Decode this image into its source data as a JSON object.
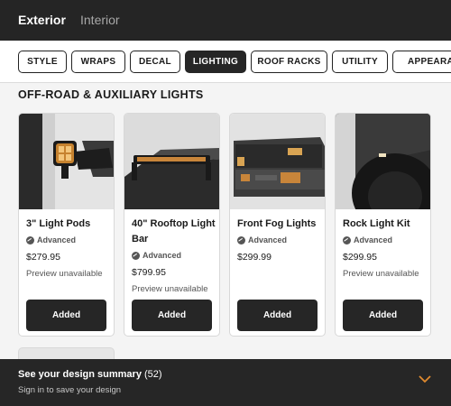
{
  "header": {
    "tabs": [
      {
        "label": "Exterior",
        "active": true
      },
      {
        "label": "Interior",
        "active": false
      }
    ]
  },
  "filters": [
    {
      "label": "STYLE",
      "active": false
    },
    {
      "label": "WRAPS",
      "active": false
    },
    {
      "label": "DECAL",
      "active": false
    },
    {
      "label": "LIGHTING",
      "active": true
    },
    {
      "label": "ROOF RACKS",
      "active": false
    },
    {
      "label": "UTILITY",
      "active": false
    },
    {
      "label": "APPEARAN",
      "active": false
    }
  ],
  "section": {
    "title": "OFF-ROAD & AUXILIARY LIGHTS"
  },
  "products": [
    {
      "name": "3\" Light Pods",
      "badge": "Advanced",
      "price": "$279.95",
      "note": "Preview unavailable",
      "button": "Added",
      "image_icon": "light-pod-image"
    },
    {
      "name": "40\" Rooftop Light Bar",
      "badge": "Advanced",
      "price": "$799.95",
      "note": "Preview unavailable",
      "button": "Added",
      "image_icon": "rooftop-light-bar-image"
    },
    {
      "name": "Front Fog Lights",
      "badge": "Advanced",
      "price": "$299.99",
      "note": "",
      "button": "Added",
      "image_icon": "fog-lights-image"
    },
    {
      "name": "Rock Light Kit",
      "badge": "Advanced",
      "price": "$299.95",
      "note": "Preview unavailable",
      "button": "Added",
      "image_icon": "rock-light-image"
    }
  ],
  "summary": {
    "title": "See your design summary",
    "count": "(52)",
    "subtitle": "Sign in to save your design",
    "chevron_icon": "chevron-down-icon"
  },
  "colors": {
    "dark": "#262626",
    "accent": "#e08a2e",
    "background": "#f4f4f4"
  }
}
